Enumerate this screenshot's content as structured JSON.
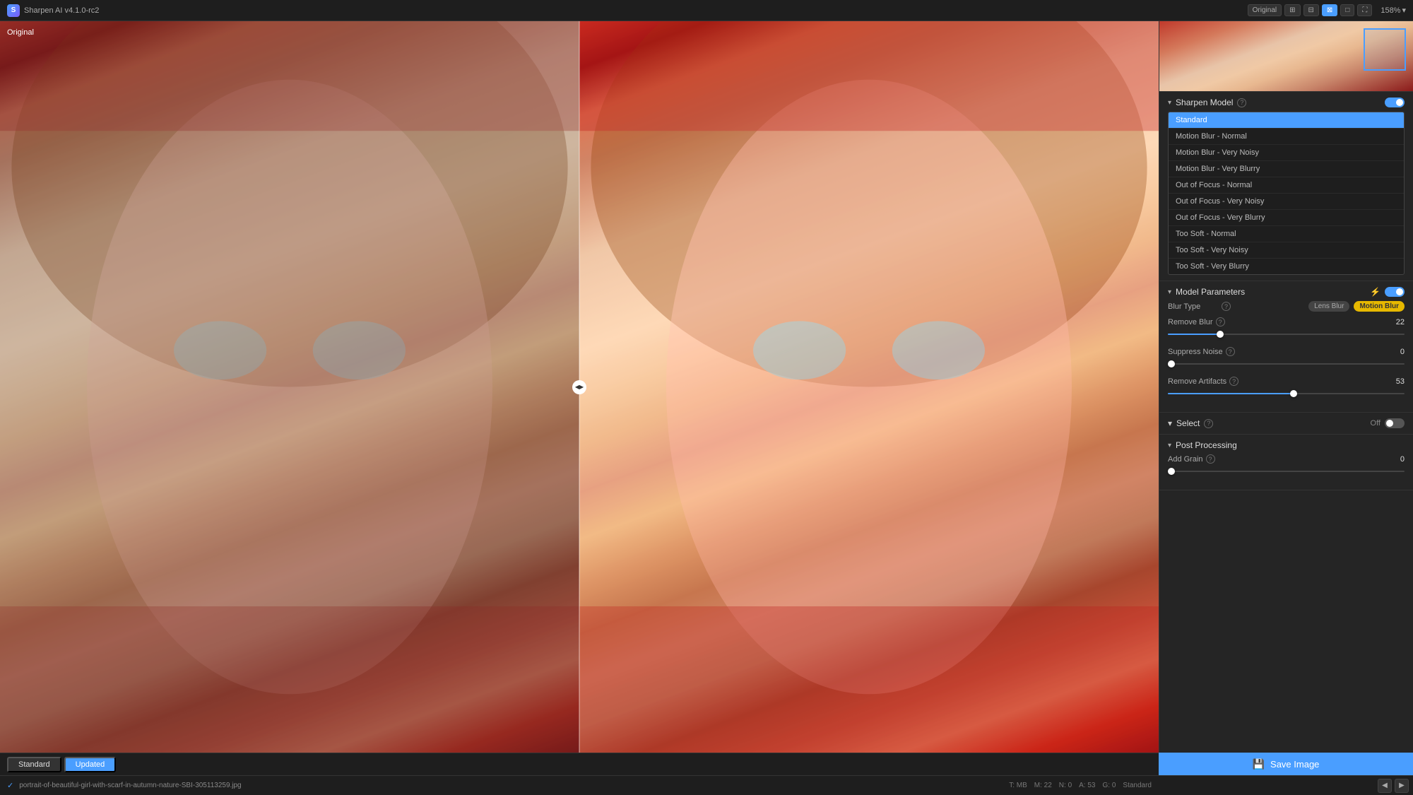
{
  "app": {
    "title": "Sharpen AI v4.1.0-rc2",
    "icon": "S"
  },
  "toolbar": {
    "original_btn": "Original",
    "view_icons": [
      "grid-1",
      "grid-2",
      "side-by-side",
      "view-box",
      "fullscreen"
    ],
    "zoom_label": "158%",
    "zoom_value": "158"
  },
  "image_labels": {
    "original": "Original"
  },
  "sharpen_model": {
    "title": "Sharpen Model",
    "items": [
      {
        "id": "standard",
        "label": "Standard",
        "selected": true
      },
      {
        "id": "motion-blur-normal",
        "label": "Motion Blur - Normal",
        "selected": false
      },
      {
        "id": "motion-blur-very-noisy",
        "label": "Motion Blur - Very Noisy",
        "selected": false
      },
      {
        "id": "motion-blur-very-blurry",
        "label": "Motion Blur - Very Blurry",
        "selected": false
      },
      {
        "id": "out-of-focus-normal",
        "label": "Out of Focus - Normal",
        "selected": false
      },
      {
        "id": "out-of-focus-very-noisy",
        "label": "Out of Focus - Very Noisy",
        "selected": false
      },
      {
        "id": "out-of-focus-very-blurry",
        "label": "Out of Focus - Very Blurry",
        "selected": false
      },
      {
        "id": "too-soft-normal",
        "label": "Too Soft - Normal",
        "selected": false
      },
      {
        "id": "too-soft-very-noisy",
        "label": "Too Soft - Very Noisy",
        "selected": false
      },
      {
        "id": "too-soft-very-blurry",
        "label": "Too Soft - Very Blurry",
        "selected": false
      }
    ]
  },
  "model_parameters": {
    "title": "Model Parameters",
    "enabled": true,
    "blur_type": {
      "label": "Blur Type",
      "options": [
        "Lens Blur",
        "Motion Blur"
      ],
      "selected": "Motion Blur"
    },
    "remove_blur": {
      "label": "Remove Blur",
      "value": 22,
      "min": 0,
      "max": 100,
      "fill_pct": 22
    },
    "suppress_noise": {
      "label": "Suppress Noise",
      "value": 0,
      "min": 0,
      "max": 100,
      "fill_pct": 0
    },
    "remove_artifacts": {
      "label": "Remove Artifacts",
      "value": 53,
      "min": 0,
      "max": 100,
      "fill_pct": 53
    }
  },
  "select": {
    "title": "Select",
    "status": "Off"
  },
  "post_processing": {
    "title": "Post Processing",
    "add_grain": {
      "label": "Add Grain",
      "value": 0,
      "min": 0,
      "max": 100,
      "fill_pct": 0
    }
  },
  "bottom_bar": {
    "check_icon": "✓",
    "filename": "portrait-of-beautiful-girl-with-scarf-in-autumn-nature-SBI-305113259.jpg",
    "meta": {
      "t": "T: MB",
      "m": "M: 22",
      "n": "N: 0",
      "a": "A: 53",
      "g": "G: 0",
      "model": "Standard"
    },
    "tabs": {
      "standard": "Standard",
      "updated": "Updated"
    },
    "std_upd_label": "Standard Updated"
  },
  "save_button": {
    "label": "Save Image",
    "icon": "💾"
  },
  "colors": {
    "accent": "#4a9eff",
    "selected_bg": "#4a9eff",
    "motion_tag": "#e6b800",
    "panel_bg": "#252525",
    "dark_bg": "#1e1e1e"
  }
}
